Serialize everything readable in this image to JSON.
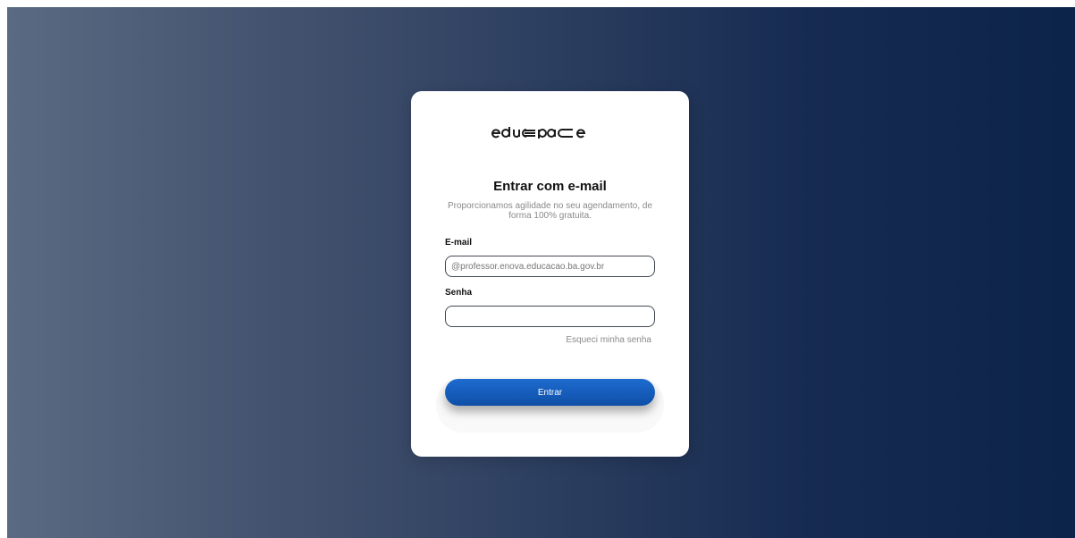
{
  "brand": {
    "logo_text": "eduspace"
  },
  "login": {
    "title": "Entrar com e-mail",
    "subtitle": "Proporcionamos agilidade no seu agendamento, de forma 100% gratuita.",
    "email_label": "E-mail",
    "email_placeholder": "@professor.enova.educacao.ba.gov.br",
    "email_value": "",
    "password_label": "Senha",
    "password_placeholder": "",
    "password_value": "",
    "forgot_link": "Esqueci minha senha",
    "submit_label": "Entrar"
  },
  "colors": {
    "background_start": "#5a6a82",
    "background_end": "#0c234a",
    "button": "#0e5bbd"
  }
}
